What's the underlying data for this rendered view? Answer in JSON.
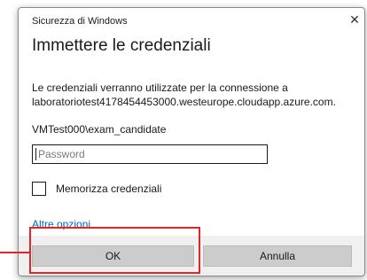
{
  "dialog": {
    "header": "Sicurezza di Windows",
    "close_glyph": "✕",
    "close_icon": "close-icon",
    "title": "Immettere le credenziali",
    "description_line1": "Le credenziali verranno utilizzate per la connessione a",
    "description_line2": "laboratoriotest4178454453000.westeurope.cloudapp.azure.com.",
    "username": "VMTest000\\exam_candidate",
    "password": {
      "value": "",
      "placeholder": "Password"
    },
    "remember_label": "Memorizza credenziali",
    "remember_checked": false,
    "more_options": "Altre opzioni",
    "ok_label": "OK",
    "cancel_label": "Annulla"
  },
  "colors": {
    "link": "#0067c0",
    "highlight": "#e0262b",
    "button": "#cccccc",
    "footer": "#f0f0f0"
  }
}
